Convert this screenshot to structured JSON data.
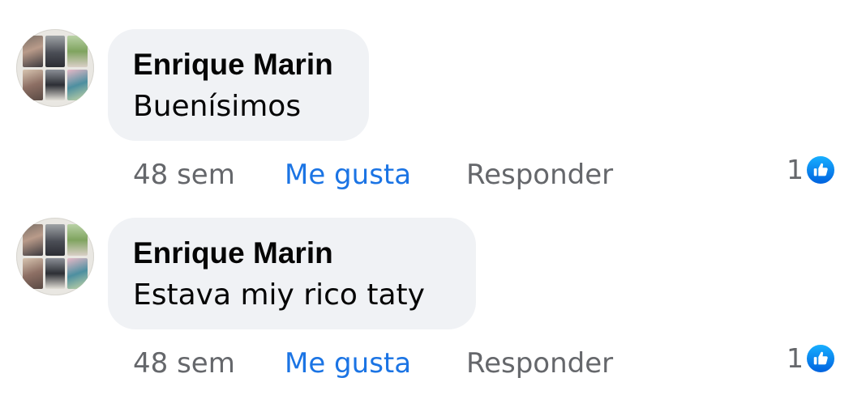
{
  "comments": [
    {
      "author": "Enrique Marin",
      "text": "Buenísimos",
      "time": "48 sem",
      "like_label": "Me gusta",
      "reply_label": "Responder",
      "reaction_count": "1",
      "reaction_icon": "thumbs-up-icon"
    },
    {
      "author": "Enrique Marin",
      "text": "Estava miy rico taty",
      "time": "48 sem",
      "like_label": "Me gusta",
      "reply_label": "Responder",
      "reaction_count": "1",
      "reaction_icon": "thumbs-up-icon"
    }
  ],
  "colors": {
    "bubble": "#f0f2f5",
    "accent": "#1b74e4",
    "muted": "#65676b",
    "text": "#050505"
  }
}
